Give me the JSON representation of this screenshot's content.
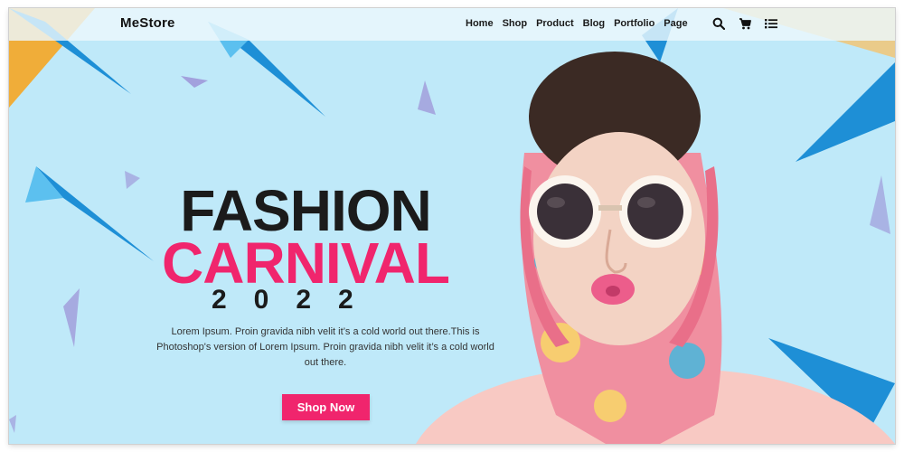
{
  "header": {
    "logo": "MeStore",
    "nav": [
      "Home",
      "Shop",
      "Product",
      "Blog",
      "Portfolio",
      "Page"
    ],
    "icons": [
      "search-icon",
      "cart-icon",
      "list-menu-icon"
    ]
  },
  "hero": {
    "title_line1": "FASHION",
    "title_line2": "CARNIVAL",
    "year": "2022",
    "description": "Lorem Ipsum. Proin gravida nibh velit it’s a cold world out there.This is Photoshop's version of Lorem Ipsum. Proin gravida nibh velit it’s a cold world out there.",
    "cta_label": "Shop Now"
  },
  "colors": {
    "background": "#bfe9f9",
    "accent": "#f0256d",
    "title_dark": "#1b1b1b",
    "deco_blue": "#1e8fd6",
    "deco_orange": "#f5a623",
    "deco_purple": "#9b8fd6"
  }
}
